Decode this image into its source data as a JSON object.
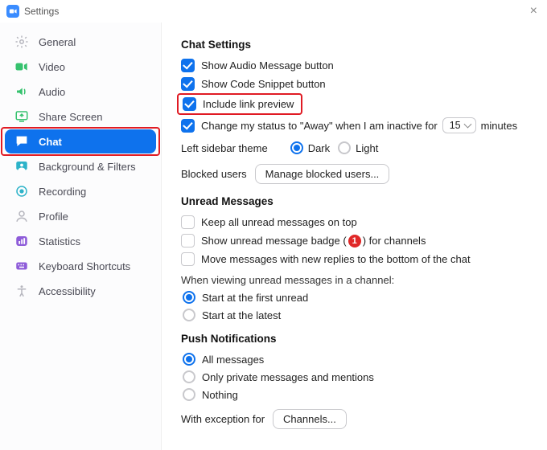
{
  "titlebar": {
    "title": "Settings"
  },
  "sidebar": {
    "items": [
      {
        "label": "General"
      },
      {
        "label": "Video"
      },
      {
        "label": "Audio"
      },
      {
        "label": "Share Screen"
      },
      {
        "label": "Chat"
      },
      {
        "label": "Background & Filters"
      },
      {
        "label": "Recording"
      },
      {
        "label": "Profile"
      },
      {
        "label": "Statistics"
      },
      {
        "label": "Keyboard Shortcuts"
      },
      {
        "label": "Accessibility"
      }
    ]
  },
  "chat_settings": {
    "heading": "Chat Settings",
    "show_audio_label": "Show Audio Message button",
    "show_code_label": "Show Code Snippet button",
    "link_preview_label": "Include link preview",
    "away_prefix": "Change my status to \"Away\" when I am inactive for",
    "away_value": "15",
    "away_suffix": "minutes",
    "theme_label": "Left sidebar theme",
    "theme_dark": "Dark",
    "theme_light": "Light",
    "blocked_label": "Blocked users",
    "blocked_button": "Manage blocked users..."
  },
  "unread": {
    "heading": "Unread Messages",
    "keep_top": "Keep all unread messages on top",
    "badge_prefix": "Show unread message badge (",
    "badge_count": "1",
    "badge_suffix": ") for channels",
    "move_bottom": "Move messages with new replies to the bottom of the chat",
    "view_label": "When viewing unread messages in a channel:",
    "start_first": "Start at the first unread",
    "start_latest": "Start at the latest"
  },
  "push": {
    "heading": "Push Notifications",
    "all": "All messages",
    "private": "Only private messages and mentions",
    "nothing": "Nothing",
    "exception_label": "With exception for",
    "exception_button": "Channels..."
  }
}
